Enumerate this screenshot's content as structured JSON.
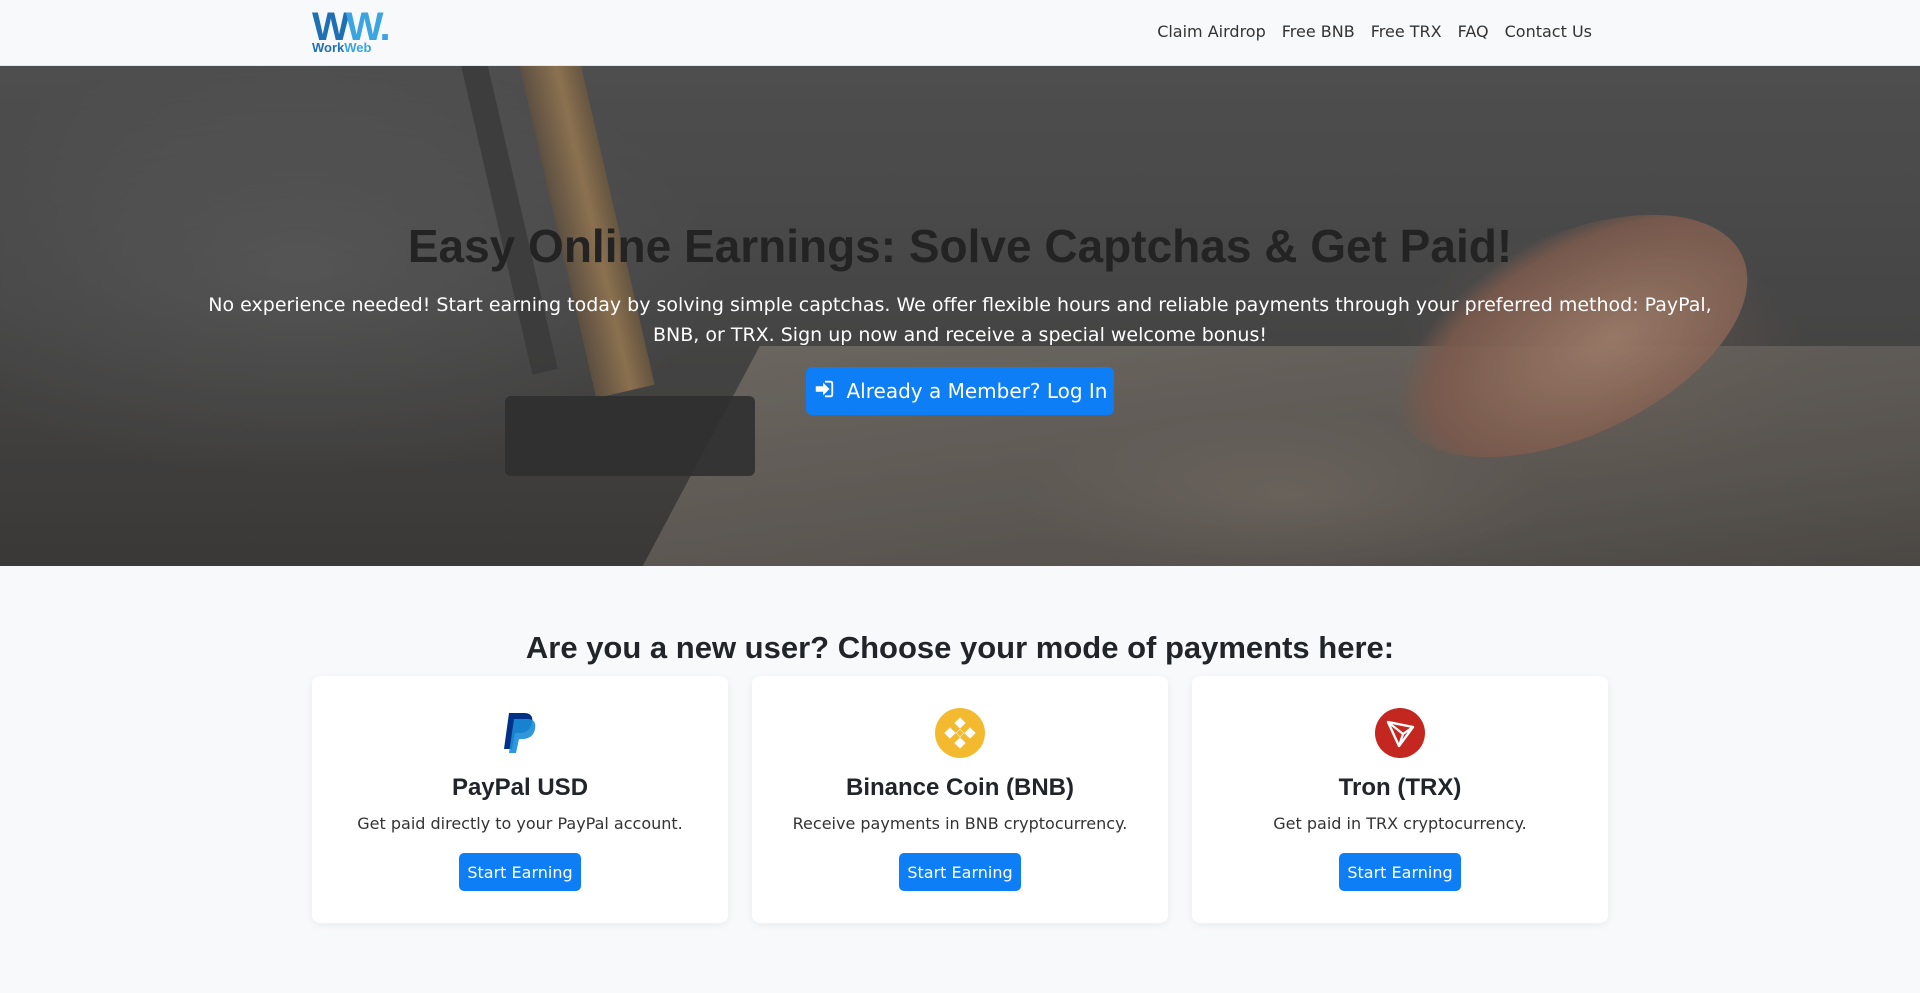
{
  "brand": {
    "logo_mark_w1": "W",
    "logo_mark_w2": "W",
    "logo_mark_dot": ".",
    "logo_text_work": "Work",
    "logo_text_web": "Web"
  },
  "nav": {
    "items": [
      {
        "label": "Claim Airdrop"
      },
      {
        "label": "Free BNB"
      },
      {
        "label": "Free TRX"
      },
      {
        "label": "FAQ"
      },
      {
        "label": "Contact Us"
      }
    ]
  },
  "hero": {
    "title": "Easy Online Earnings: Solve Captchas & Get Paid!",
    "description": "No experience needed! Start earning today by solving simple captchas. We offer flexible hours and reliable payments through your preferred method: PayPal, BNB, or TRX. Sign up now and receive a special welcome bonus!",
    "login_button": "Already a Member? Log In",
    "login_icon": "sign-in-icon"
  },
  "payments": {
    "title": "Are you a new user? Choose your mode of payments here:",
    "cards": [
      {
        "icon": "paypal-icon",
        "title": "PayPal USD",
        "description": "Get paid directly to your PayPal account.",
        "button": "Start Earning",
        "accent": "#003087"
      },
      {
        "icon": "binance-icon",
        "title": "Binance Coin (BNB)",
        "description": "Receive payments in BNB cryptocurrency.",
        "button": "Start Earning",
        "accent": "#f3ba2f"
      },
      {
        "icon": "tron-icon",
        "title": "Tron (TRX)",
        "description": "Get paid in TRX cryptocurrency.",
        "button": "Start Earning",
        "accent": "#c4271f"
      }
    ]
  },
  "colors": {
    "primary": "#0d7ef5",
    "background": "#f8f9fa"
  }
}
